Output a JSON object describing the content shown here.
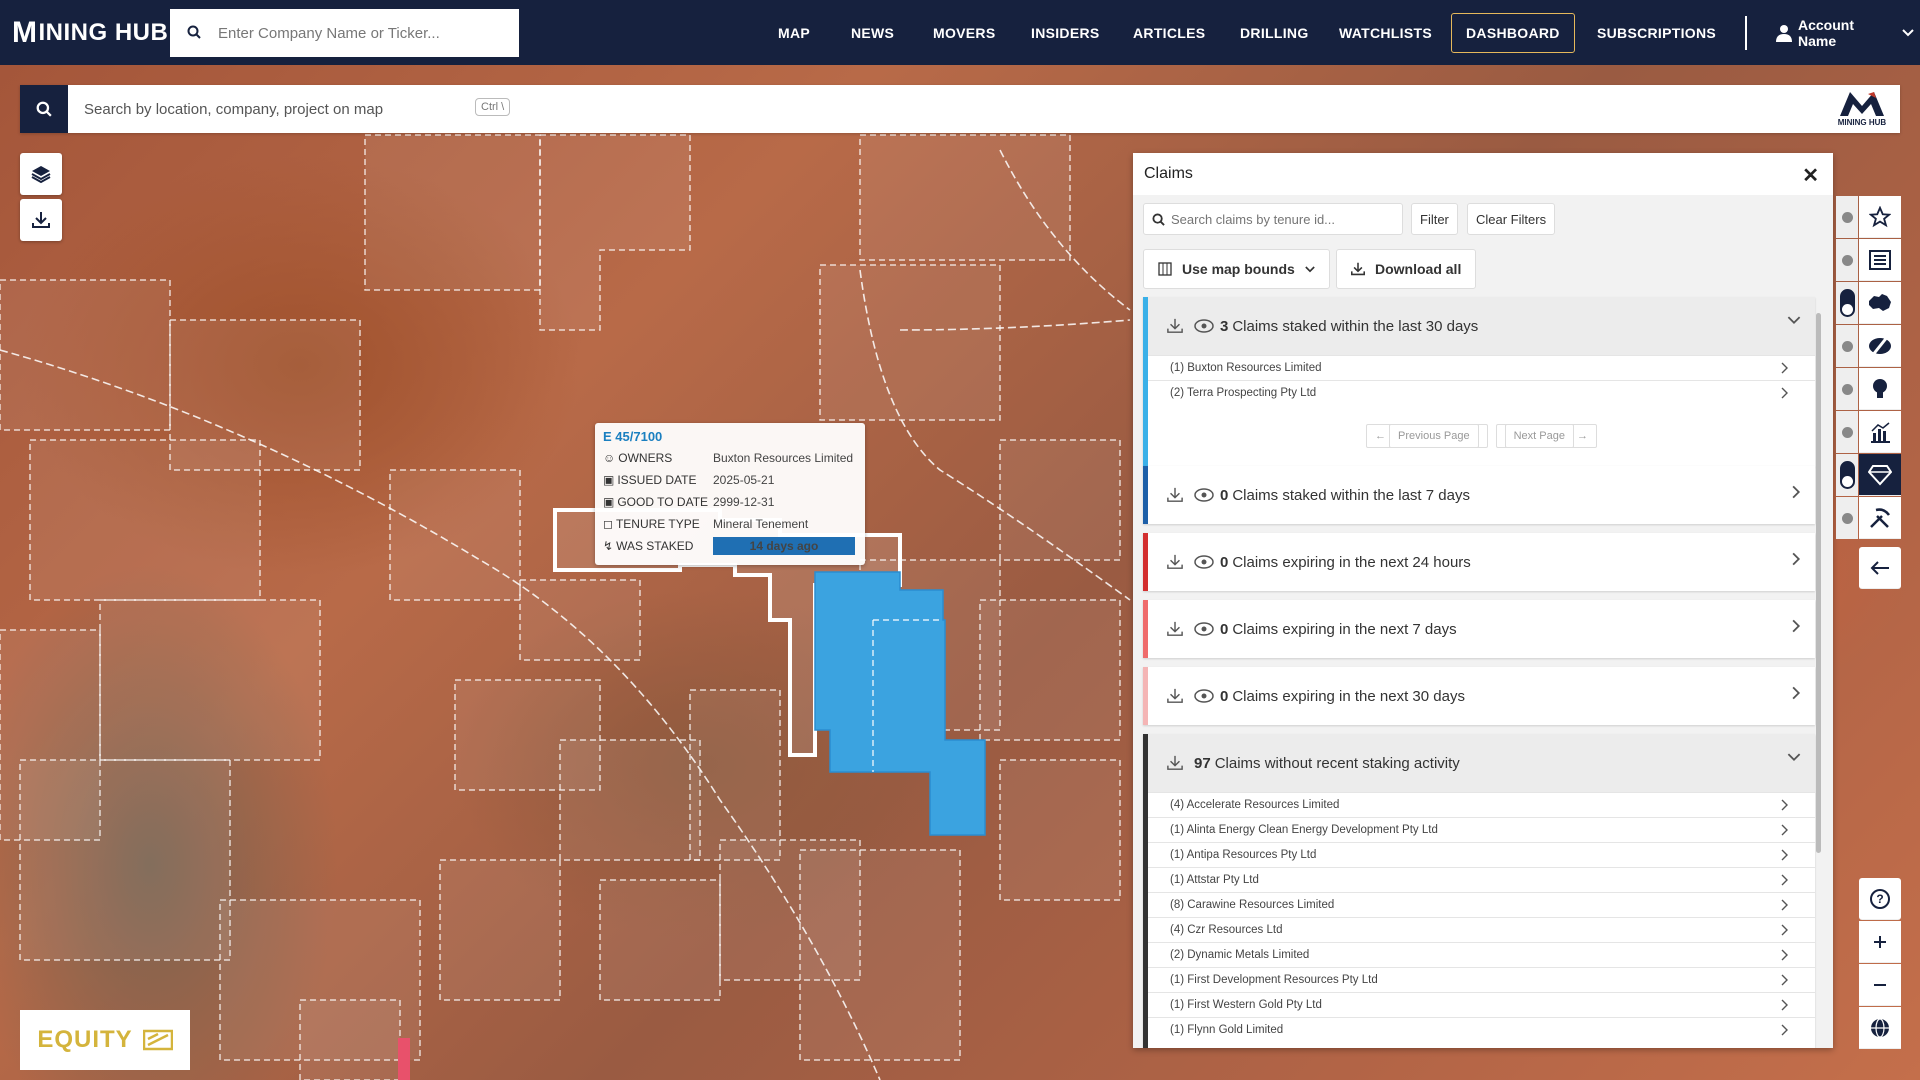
{
  "brand": {
    "name": "INING HUB",
    "name_prefix": "M",
    "small_logo_caption": "MINING HUB"
  },
  "top_search": {
    "placeholder": "Enter Company Name or Ticker..."
  },
  "nav": {
    "items": [
      {
        "label": "MAP"
      },
      {
        "label": "NEWS"
      },
      {
        "label": "MOVERS"
      },
      {
        "label": "INSIDERS"
      },
      {
        "label": "ARTICLES"
      },
      {
        "label": "DRILLING"
      },
      {
        "label": "WATCHLISTS"
      },
      {
        "label": "DASHBOARD"
      },
      {
        "label": "SUBSCRIPTIONS"
      }
    ],
    "active": "DASHBOARD",
    "account_label": "Account Name"
  },
  "map_search": {
    "placeholder": "Search by location, company, project on map",
    "shortcut": "Ctrl \\"
  },
  "popup": {
    "title": "E 45/7100",
    "rows": [
      {
        "key": "OWNERS",
        "value": "Buxton Resources Limited",
        "icon": "person-icon"
      },
      {
        "key": "ISSUED DATE",
        "value": "2025-05-21",
        "icon": "calendar-icon"
      },
      {
        "key": "GOOD TO DATE",
        "value": "2999-12-31",
        "icon": "calendar-icon"
      },
      {
        "key": "TENURE TYPE",
        "value": "Mineral Tenement",
        "icon": "bookmark-icon"
      },
      {
        "key": "WAS STAKED",
        "value": "14 days ago",
        "icon": "bolt-icon"
      }
    ]
  },
  "claims_panel": {
    "title": "Claims",
    "search_placeholder": "Search claims by tenure id...",
    "filter_label": "Filter",
    "clear_filters_label": "Clear Filters",
    "bounds_label": "Use map bounds",
    "download_all_label": "Download all",
    "sections": [
      {
        "count": "3",
        "label": "Claims staked within the last 30 days",
        "accent": "#3ab0e8",
        "expanded": true,
        "items": [
          "(1) Buxton Resources Limited",
          "(2) Terra Prospecting Pty Ltd"
        ],
        "prev_label": "Previous Page",
        "next_label": "Next Page"
      },
      {
        "count": "0",
        "label": "Claims staked within the last 7 days",
        "accent": "#1d5fa8",
        "expanded": false
      },
      {
        "count": "0",
        "label": "Claims expiring in the next 24 hours",
        "accent": "#d32f2f",
        "expanded": false
      },
      {
        "count": "0",
        "label": "Claims expiring in the next 7 days",
        "accent": "#ef6b6b",
        "expanded": false
      },
      {
        "count": "0",
        "label": "Claims expiring in the next 30 days",
        "accent": "#f4b5b5",
        "expanded": false
      },
      {
        "count": "97",
        "label": "Claims without recent staking activity",
        "accent": "#333333",
        "expanded": true,
        "items": [
          "(4) Accelerate Resources Limited",
          "(1) Alinta Energy Clean Energy Development Pty Ltd",
          "(1) Antipa Resources Pty Ltd",
          "(1) Attstar Pty Ltd",
          "(8) Carawine Resources Limited",
          "(4) Czr Resources Ltd",
          "(2) Dynamic Metals Limited",
          "(1) First Development Resources Pty Ltd",
          "(1) First Western Gold Pty Ltd",
          "(1) Flynn Gold Limited"
        ]
      }
    ]
  },
  "right_toolbar": [
    "star-icon",
    "news-icon",
    "australia-icon",
    "no-drilling-icon",
    "lightbulb-icon",
    "chart-icon",
    "gem-icon",
    "pickaxe-icon"
  ],
  "equity_badge": "EQUITY"
}
